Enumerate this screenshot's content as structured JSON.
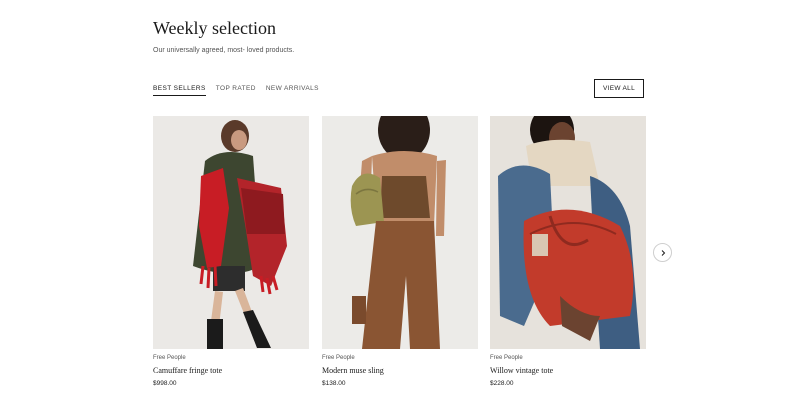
{
  "header": {
    "title": "Weekly selection",
    "subtitle": "Our universally agreed, most- loved products."
  },
  "tabs": [
    {
      "label": "BEST SELLERS",
      "active": true
    },
    {
      "label": "TOP RATED",
      "active": false
    },
    {
      "label": "NEW ARRIVALS",
      "active": false
    }
  ],
  "view_all_label": "VIEW ALL",
  "products": [
    {
      "brand": "Free People",
      "name": "Camuffare fringe tote",
      "price": "$998.00"
    },
    {
      "brand": "Free People",
      "name": "Modern muse sling",
      "price": "$138.00"
    },
    {
      "brand": "Free People",
      "name": "Willow vintage tote",
      "price": "$228.00"
    }
  ],
  "icons": {
    "next": "chevron-right-icon"
  },
  "colors": {
    "text": "#1a1a1a",
    "muted": "#555555",
    "image_bg": "#ebe9e6"
  }
}
